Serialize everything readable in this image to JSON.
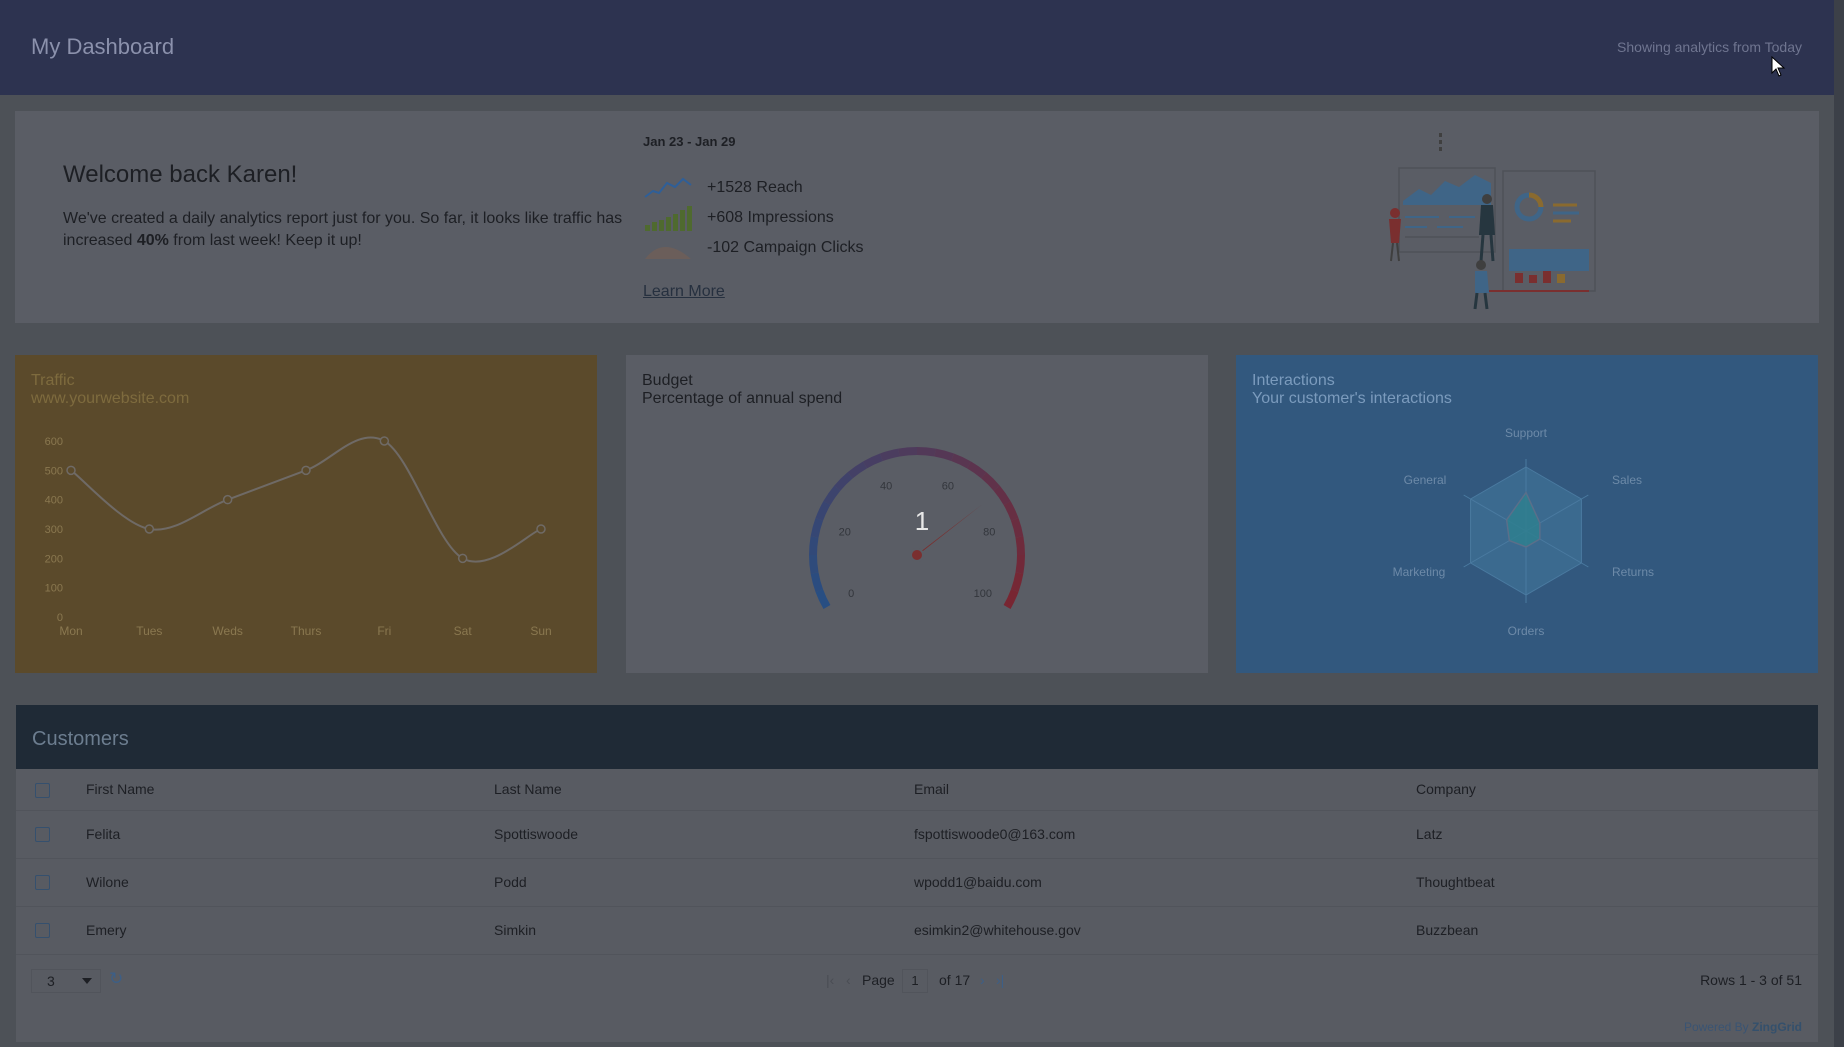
{
  "header": {
    "title": "My Dashboard",
    "range_text": "Showing analytics from Today"
  },
  "welcome": {
    "greeting": "Welcome back Karen!",
    "message_before": "We've created a daily analytics report just for you. So far, it looks like traffic has increased ",
    "message_highlight": "40%",
    "message_after": " from last week! Keep it up!",
    "week_range": "Jan 23 - Jan 29",
    "stats": [
      {
        "label": "+1528 Reach",
        "icon": "line-trend-icon"
      },
      {
        "label": "+608 Impressions",
        "icon": "bar-trend-icon"
      },
      {
        "label": "-102 Campaign Clicks",
        "icon": "area-trend-icon"
      }
    ],
    "learn_more": "Learn More"
  },
  "traffic": {
    "title": "Traffic",
    "subtitle": "www.yourwebsite.com",
    "chart_data": {
      "type": "line",
      "categories": [
        "Mon",
        "Tues",
        "Weds",
        "Thurs",
        "Fri",
        "Sat",
        "Sun"
      ],
      "values": [
        500,
        300,
        400,
        500,
        600,
        200,
        300
      ],
      "ylim": [
        0,
        600
      ],
      "yticks": [
        "0",
        "100",
        "200",
        "300",
        "400",
        "500",
        "600"
      ]
    }
  },
  "budget": {
    "title": "Budget",
    "subtitle": "Percentage of annual spend",
    "gauge": {
      "value": 1,
      "min": 0,
      "max": 100,
      "ticks": [
        "0",
        "20",
        "40",
        "60",
        "80",
        "100"
      ]
    }
  },
  "interactions": {
    "title": "Interactions",
    "subtitle": "Your customer's interactions",
    "chart_data": {
      "type": "radar",
      "axes": [
        "Support",
        "Sales",
        "Returns",
        "Orders",
        "Marketing",
        "General"
      ],
      "values": [
        0.6,
        0.25,
        0.25,
        0.25,
        0.3,
        0.35
      ]
    }
  },
  "customers": {
    "title": "Customers",
    "columns": [
      "First Name",
      "Last Name",
      "Email",
      "Company"
    ],
    "rows": [
      [
        "Felita",
        "Spottiswoode",
        "fspottiswoode0@163.com",
        "Latz"
      ],
      [
        "Wilone",
        "Podd",
        "wpodd1@baidu.com",
        "Thoughtbeat"
      ],
      [
        "Emery",
        "Simkin",
        "esimkin2@whitehouse.gov",
        "Buzzbean"
      ]
    ],
    "page_size": "3",
    "page_label": "Page",
    "page_value": "1",
    "page_of": "of 17",
    "rows_info": "Rows 1 - 3 of 51",
    "powered_by": "Powered By",
    "powered_brand": "ZingGrid"
  }
}
